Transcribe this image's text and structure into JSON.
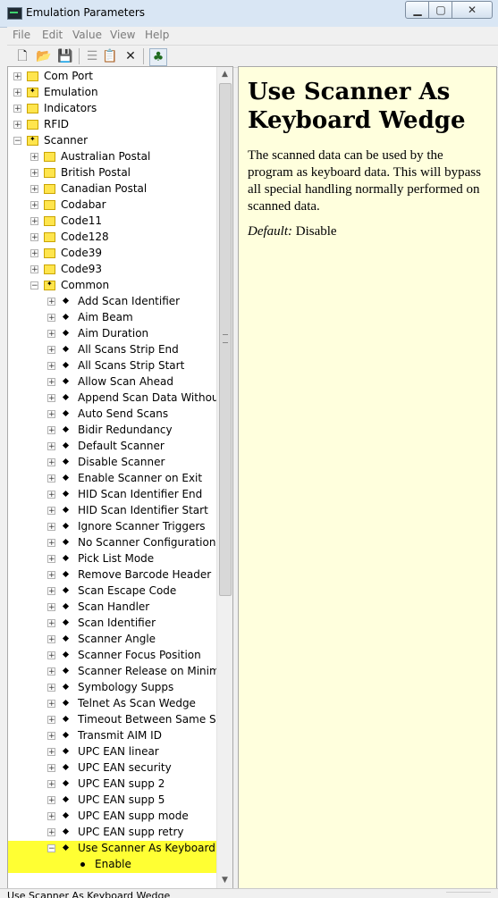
{
  "window": {
    "title": "Emulation Parameters"
  },
  "menu": [
    "File",
    "Edit",
    "Value",
    "View",
    "Help"
  ],
  "toolbar": [
    "new-icon",
    "open-icon",
    "save-icon",
    "list-icon",
    "properties-icon",
    "delete-icon",
    "tree-icon"
  ],
  "tree": [
    {
      "label": "Com Port",
      "level": 0,
      "type": "folder",
      "exp": "+"
    },
    {
      "label": "Emulation",
      "level": 0,
      "type": "folder-star",
      "exp": "+"
    },
    {
      "label": "Indicators",
      "level": 0,
      "type": "folder",
      "exp": "+"
    },
    {
      "label": "RFID",
      "level": 0,
      "type": "folder",
      "exp": "+"
    },
    {
      "label": "Scanner",
      "level": 0,
      "type": "folder-star",
      "exp": "-"
    },
    {
      "label": "Australian Postal",
      "level": 1,
      "type": "folder",
      "exp": "+"
    },
    {
      "label": "British Postal",
      "level": 1,
      "type": "folder",
      "exp": "+"
    },
    {
      "label": "Canadian Postal",
      "level": 1,
      "type": "folder",
      "exp": "+"
    },
    {
      "label": "Codabar",
      "level": 1,
      "type": "folder",
      "exp": "+"
    },
    {
      "label": "Code11",
      "level": 1,
      "type": "folder",
      "exp": "+"
    },
    {
      "label": "Code128",
      "level": 1,
      "type": "folder",
      "exp": "+"
    },
    {
      "label": "Code39",
      "level": 1,
      "type": "folder",
      "exp": "+"
    },
    {
      "label": "Code93",
      "level": 1,
      "type": "folder",
      "exp": "+"
    },
    {
      "label": "Common",
      "level": 1,
      "type": "folder-star",
      "exp": "-"
    },
    {
      "label": "Add Scan Identifier",
      "level": 2,
      "type": "setting",
      "exp": "+"
    },
    {
      "label": "Aim Beam",
      "level": 2,
      "type": "setting",
      "exp": "+"
    },
    {
      "label": "Aim Duration",
      "level": 2,
      "type": "setting",
      "exp": "+"
    },
    {
      "label": "All Scans Strip End",
      "level": 2,
      "type": "setting",
      "exp": "+"
    },
    {
      "label": "All Scans Strip Start",
      "level": 2,
      "type": "setting",
      "exp": "+"
    },
    {
      "label": "Allow Scan Ahead",
      "level": 2,
      "type": "setting",
      "exp": "+"
    },
    {
      "label": "Append Scan Data Without CI",
      "level": 2,
      "type": "setting",
      "exp": "+"
    },
    {
      "label": "Auto Send Scans",
      "level": 2,
      "type": "setting",
      "exp": "+"
    },
    {
      "label": "Bidir Redundancy",
      "level": 2,
      "type": "setting",
      "exp": "+"
    },
    {
      "label": "Default Scanner",
      "level": 2,
      "type": "setting",
      "exp": "+"
    },
    {
      "label": "Disable Scanner",
      "level": 2,
      "type": "setting",
      "exp": "+"
    },
    {
      "label": "Enable Scanner on Exit",
      "level": 2,
      "type": "setting",
      "exp": "+"
    },
    {
      "label": "HID Scan Identifier End",
      "level": 2,
      "type": "setting",
      "exp": "+"
    },
    {
      "label": "HID Scan Identifier Start",
      "level": 2,
      "type": "setting",
      "exp": "+"
    },
    {
      "label": "Ignore Scanner Triggers",
      "level": 2,
      "type": "setting",
      "exp": "+"
    },
    {
      "label": "No Scanner Configuration",
      "level": 2,
      "type": "setting",
      "exp": "+"
    },
    {
      "label": "Pick List Mode",
      "level": 2,
      "type": "setting",
      "exp": "+"
    },
    {
      "label": "Remove Barcode Header",
      "level": 2,
      "type": "setting",
      "exp": "+"
    },
    {
      "label": "Scan Escape Code",
      "level": 2,
      "type": "setting",
      "exp": "+"
    },
    {
      "label": "Scan Handler",
      "level": 2,
      "type": "setting",
      "exp": "+"
    },
    {
      "label": "Scan Identifier",
      "level": 2,
      "type": "setting",
      "exp": "+"
    },
    {
      "label": "Scanner Angle",
      "level": 2,
      "type": "setting",
      "exp": "+"
    },
    {
      "label": "Scanner Focus Position",
      "level": 2,
      "type": "setting",
      "exp": "+"
    },
    {
      "label": "Scanner Release on Minimize",
      "level": 2,
      "type": "setting",
      "exp": "+"
    },
    {
      "label": "Symbology Supps",
      "level": 2,
      "type": "setting",
      "exp": "+"
    },
    {
      "label": "Telnet As Scan Wedge",
      "level": 2,
      "type": "setting",
      "exp": "+"
    },
    {
      "label": "Timeout Between Same Symb",
      "level": 2,
      "type": "setting",
      "exp": "+"
    },
    {
      "label": "Transmit AIM ID",
      "level": 2,
      "type": "setting",
      "exp": "+"
    },
    {
      "label": "UPC EAN linear",
      "level": 2,
      "type": "setting",
      "exp": "+"
    },
    {
      "label": "UPC EAN security",
      "level": 2,
      "type": "setting",
      "exp": "+"
    },
    {
      "label": "UPC EAN supp 2",
      "level": 2,
      "type": "setting",
      "exp": "+"
    },
    {
      "label": "UPC EAN supp 5",
      "level": 2,
      "type": "setting",
      "exp": "+"
    },
    {
      "label": "UPC EAN supp mode",
      "level": 2,
      "type": "setting",
      "exp": "+"
    },
    {
      "label": "UPC EAN supp retry",
      "level": 2,
      "type": "setting",
      "exp": "+"
    },
    {
      "label": "Use Scanner As Keyboard Wec",
      "level": 2,
      "type": "setting",
      "exp": "-",
      "highlight": true
    },
    {
      "label": "Enable",
      "level": 3,
      "type": "value",
      "exp": "",
      "highlight": true
    }
  ],
  "help": {
    "title": "Use Scanner As Keyboard Wedge",
    "body": "The scanned data can be used by the program as keyboard data. This  will bypass all special handling normally performed on scanned data.",
    "default_label": "Default:",
    "default_value": "Disable"
  },
  "status": {
    "text": "Use Scanner As Keyboard Wedge"
  },
  "colors": {
    "help_bg": "#ffffdd",
    "highlight": "#ffff33",
    "folder": "#ffe54d"
  }
}
